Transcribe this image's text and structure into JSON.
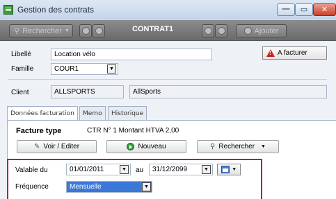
{
  "window": {
    "title": "Gestion des contrats",
    "minimize_glyph": "—",
    "maximize_glyph": "▭",
    "close_glyph": "✕"
  },
  "toolbar": {
    "search_label": "Rechercher",
    "record_title": "CONTRAT1",
    "add_label": "Ajouter"
  },
  "form": {
    "libelle_label": "Libellé",
    "libelle_value": "Location vélo",
    "famille_label": "Famille",
    "famille_value": "COUR1",
    "status_badge": "A facturer",
    "client_label": "Client",
    "client_code": "ALLSPORTS",
    "client_name": "AllSports"
  },
  "tabs": [
    "Données facturation",
    "Memo",
    "Historique"
  ],
  "billing": {
    "facture_type_label": "Facture type",
    "facture_type_value": "CTR N° 1 Montant HTVA 2,00",
    "voir_button": "Voir / Editer",
    "nouveau_button": "Nouveau",
    "rechercher_button": "Rechercher",
    "valable_label": "Valable du",
    "date_from": "01/01/2011",
    "au_label": "au",
    "date_to": "31/12/2099",
    "frequence_label": "Fréquence",
    "frequence_value": "Mensuelle"
  },
  "icons": {
    "app": "app-icon",
    "search": "binoculars-icon",
    "nav": "arrow-circle-icon",
    "warning": "warning-icon",
    "calendar": "calendar-icon"
  }
}
